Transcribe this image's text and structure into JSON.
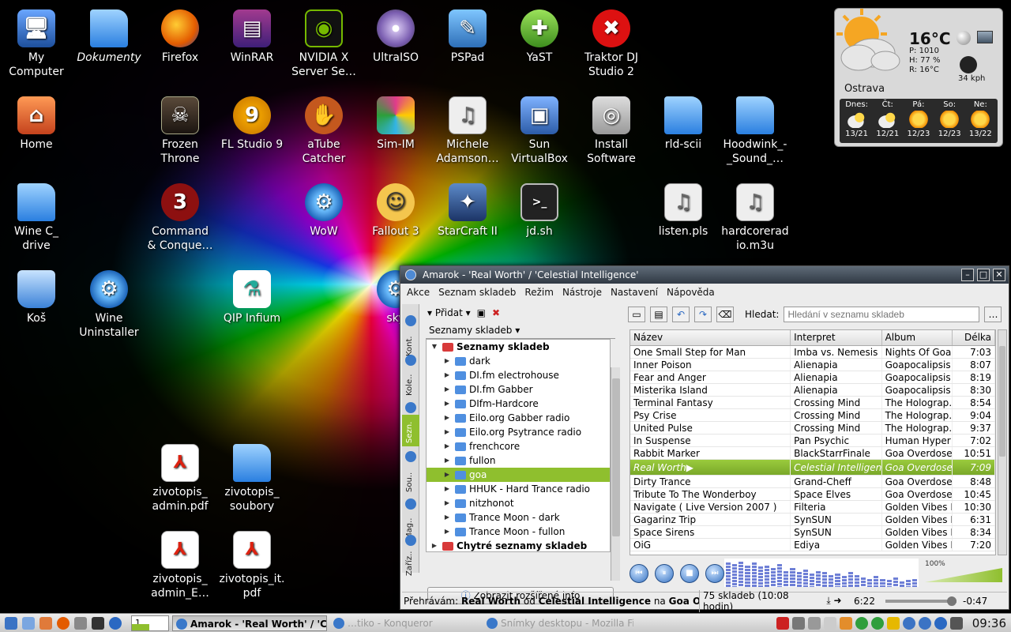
{
  "desktop": {
    "icons": [
      {
        "label": "My\nComputer",
        "glyph": "🖥",
        "style": "computer"
      },
      {
        "label": "Dokumenty",
        "glyph": "",
        "style": "folder"
      },
      {
        "label": "Firefox",
        "glyph": "",
        "style": "firefox"
      },
      {
        "label": "WinRAR",
        "glyph": "▤",
        "style": "winrar"
      },
      {
        "label": "NVIDIA X\nServer Se…",
        "glyph": "◉",
        "style": "nvidia"
      },
      {
        "label": "UltraISO",
        "glyph": "",
        "style": "disc"
      },
      {
        "label": "PSPad",
        "glyph": "✎",
        "style": "pspad"
      },
      {
        "label": "YaST",
        "glyph": "✚",
        "style": "yast"
      },
      {
        "label": "Traktor DJ\nStudio 2",
        "glyph": "✖",
        "style": "traktor"
      },
      {
        "label": "Home",
        "glyph": "⌂",
        "style": "home"
      },
      {
        "label": "Frozen\nThrone",
        "glyph": "☠",
        "style": "frozen"
      },
      {
        "label": "FL Studio 9",
        "glyph": "9",
        "style": "fl"
      },
      {
        "label": "aTube\nCatcher",
        "glyph": "✋",
        "style": "atube"
      },
      {
        "label": "Sim-IM",
        "glyph": "",
        "style": "simim"
      },
      {
        "label": "Michele\nAdamson…",
        "glyph": "♫",
        "style": "file"
      },
      {
        "label": "Sun\nVirtualBox",
        "glyph": "▣",
        "style": "vbox"
      },
      {
        "label": "Install\nSoftware",
        "glyph": "◎",
        "style": "install"
      },
      {
        "label": "rld-scii",
        "glyph": "",
        "style": "folder"
      },
      {
        "label": "Hoodwink_-\n_Sound_…",
        "glyph": "",
        "style": "folder"
      },
      {
        "label": "Wine C_\ndrive",
        "glyph": "",
        "style": "folder"
      },
      {
        "label": "Command\n& Conque…",
        "glyph": "3",
        "style": "cnc"
      },
      {
        "label": "WoW",
        "glyph": "⚙",
        "style": "gear"
      },
      {
        "label": "Fallout 3",
        "glyph": "☺",
        "style": "fallout"
      },
      {
        "label": "StarCraft II",
        "glyph": "✦",
        "style": "sc"
      },
      {
        "label": "jd.sh",
        "glyph": ">_",
        "style": "term"
      },
      {
        "label": "listen.pls",
        "glyph": "♫",
        "style": "file"
      },
      {
        "label": "hardcorerad\nio.m3u",
        "glyph": "♫",
        "style": "file"
      },
      {
        "label": "Koš",
        "glyph": "",
        "style": "trash"
      },
      {
        "label": "Wine\nUninstaller",
        "glyph": "⚙",
        "style": "gear"
      },
      {
        "label": "QIP Infium",
        "glyph": "⚗",
        "style": "qip"
      },
      {
        "label": "sky",
        "glyph": "⚙",
        "style": "gear"
      },
      {
        "label": "zivotopis_\nadmin.pdf",
        "glyph": "⅄",
        "style": "pdf"
      },
      {
        "label": "zivotopis_\nsoubory",
        "glyph": "",
        "style": "folder"
      },
      {
        "label": "zivotopis_\nadmin_E…",
        "glyph": "⅄",
        "style": "pdf"
      },
      {
        "label": "zivotopis_it.\npdf",
        "glyph": "⅄",
        "style": "pdf"
      }
    ]
  },
  "weather": {
    "temp": "16°C",
    "pressure": "P: 1010",
    "humidity": "H: 77 %",
    "realfeel": "R: 16°C",
    "wind": "34 kph",
    "city": "Ostrava",
    "forecast": [
      {
        "day": "Dnes:",
        "temps": "13/21",
        "icon": "cloudy"
      },
      {
        "day": "Čt:",
        "temps": "12/21",
        "icon": "cloudy"
      },
      {
        "day": "Pá:",
        "temps": "12/23",
        "icon": "sun"
      },
      {
        "day": "So:",
        "temps": "12/23",
        "icon": "sun"
      },
      {
        "day": "Ne:",
        "temps": "13/22",
        "icon": "sun"
      }
    ]
  },
  "amarok": {
    "title": "Amarok - 'Real Worth' / 'Celestial Intelligence'",
    "menu": [
      "Akce",
      "Seznam skladeb",
      "Režim",
      "Nástroje",
      "Nastavení",
      "Nápověda"
    ],
    "side_tabs": [
      "Kont.",
      "Kole..",
      "Sezn.",
      "Sou..",
      "Mag..",
      "Zaříz.."
    ],
    "add_label": "Přidat",
    "selector_label": "Seznamy skladeb",
    "tree": [
      {
        "label": "Seznamy skladeb",
        "level": 0,
        "expanded": true,
        "bold": true,
        "red": true
      },
      {
        "label": "dark",
        "level": 1
      },
      {
        "label": "DI.fm electrohouse",
        "level": 1
      },
      {
        "label": "DI.fm Gabber",
        "level": 1
      },
      {
        "label": "DIfm-Hardcore",
        "level": 1
      },
      {
        "label": "Eilo.org Gabber radio",
        "level": 1
      },
      {
        "label": "Eilo.org Psytrance radio",
        "level": 1
      },
      {
        "label": "frenchcore",
        "level": 1
      },
      {
        "label": "fullon",
        "level": 1
      },
      {
        "label": "goa",
        "level": 1,
        "selected": true
      },
      {
        "label": "HHUK - Hard Trance radio",
        "level": 1
      },
      {
        "label": "nitzhonot",
        "level": 1
      },
      {
        "label": "Trance Moon - dark",
        "level": 1
      },
      {
        "label": "Trance Moon - fullon",
        "level": 1
      },
      {
        "label": "Chytré seznamy skladeb",
        "level": 0,
        "bold": true,
        "red": true
      }
    ],
    "info_button": "Zobrazit rozšířené info",
    "filter_label": "Hledat:",
    "filter_placeholder": "Hledání v seznamu skladeb",
    "columns": [
      "Název",
      "Interpret",
      "Album",
      "Délka"
    ],
    "tracks": [
      [
        "One Small Step for Man",
        "Imba vs. Nemesis",
        "Nights Of Goa",
        "7:03"
      ],
      [
        "Inner Poison",
        "Alienapia",
        "Goapocalipsis",
        "8:07"
      ],
      [
        "Fear and Anger",
        "Alienapia",
        "Goapocalipsis",
        "8:19"
      ],
      [
        "Misterika Island",
        "Alienapia",
        "Goapocalipsis",
        "8:30"
      ],
      [
        "Terminal Fantasy",
        "Crossing Mind",
        "The Holograp…",
        "8:54"
      ],
      [
        "Psy Crise",
        "Crossing Mind",
        "The Holograp…",
        "9:04"
      ],
      [
        "United Pulse",
        "Crossing Mind",
        "The Holograp…",
        "9:37"
      ],
      [
        "In Suspense",
        "Pan Psychic",
        "Human Hyper…",
        "7:02"
      ],
      [
        "Rabbit Marker",
        "BlackStarrFinale",
        "Goa Overdose",
        "10:51"
      ],
      [
        "Real Worth",
        "Celestial Intelligen…",
        "Goa Overdose",
        "7:09"
      ],
      [
        "Dirty Trance",
        "Grand-Cheff",
        "Goa Overdose",
        "8:48"
      ],
      [
        "Tribute To The Wonderboy",
        "Space Elves",
        "Goa Overdose",
        "10:45"
      ],
      [
        "Navigate ( Live Version 2007 )",
        "Filteria",
        "Golden Vibes II",
        "10:30"
      ],
      [
        "Gagarinz Trip",
        "SynSUN",
        "Golden Vibes II",
        "6:31"
      ],
      [
        "Space Sirens",
        "SynSUN",
        "Golden Vibes II",
        "8:34"
      ],
      [
        "OiG",
        "Ediya",
        "Golden Vibes II",
        "7:20"
      ]
    ],
    "current_index": 9,
    "volume": "100%",
    "analyzer_levels": [
      0.9,
      0.85,
      0.95,
      0.8,
      0.9,
      0.75,
      0.8,
      0.7,
      0.85,
      0.6,
      0.7,
      0.55,
      0.65,
      0.5,
      0.6,
      0.55,
      0.45,
      0.5,
      0.4,
      0.55,
      0.45,
      0.35,
      0.3,
      0.4,
      0.3,
      0.25,
      0.35,
      0.2,
      0.25,
      0.3
    ],
    "status_prefix": "Přehrávám:",
    "status_track": "Real Worth",
    "status_by": "od",
    "status_artist": "Celestial Intelligence",
    "status_on": "na",
    "status_album": "Goa Overdos…",
    "track_count": "75 skladeb (10:08 hodin)",
    "elapsed": "6:22",
    "remaining": "-0:47"
  },
  "taskbar": {
    "pager": "1",
    "tasks": [
      {
        "label": "Amarok - 'Real Worth' / 'Celes…",
        "active": true
      },
      {
        "label": "…tiko - Konqueror",
        "active": false
      },
      {
        "label": "Snímky desktopu - Mozilla Fi…",
        "active": false
      }
    ],
    "clock": "09:36"
  },
  "colors": {
    "accent": "#8fbf2e",
    "titlebar": "#303944"
  }
}
